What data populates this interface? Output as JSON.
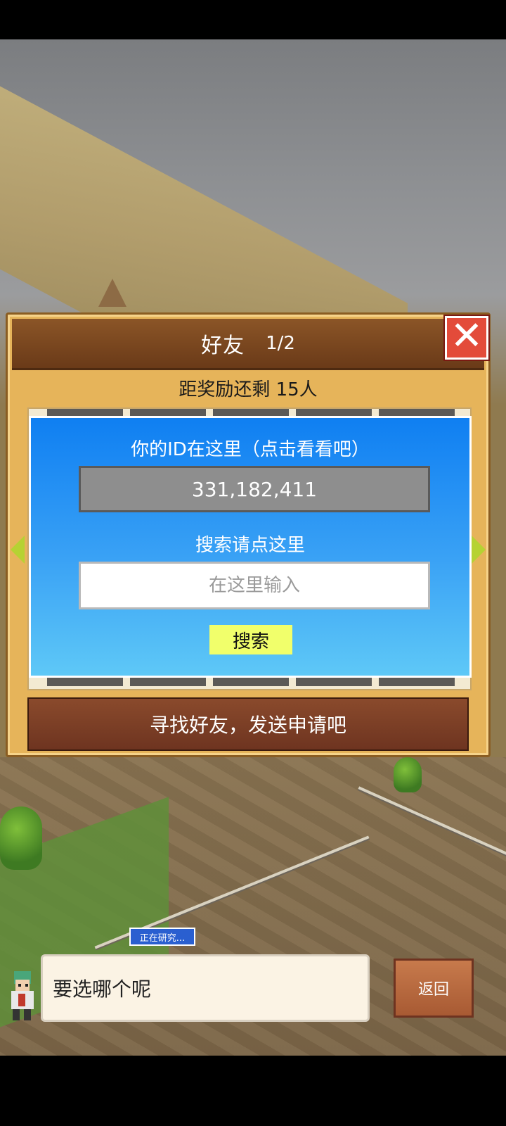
{
  "dialog": {
    "title": "好友",
    "page": "1/2",
    "close_icon": "✕",
    "reward_text": "距奖励还剩 15人",
    "id_label": "你的ID在这里（点击看看吧）",
    "id_value": "331,182,411",
    "search_label": "搜索请点这里",
    "search_placeholder": "在这里输入",
    "search_button": "搜索",
    "find_button": "寻找好友，发送申请吧"
  },
  "status": {
    "research_tag": "正在研究..."
  },
  "speech": {
    "text": "要选哪个呢"
  },
  "controls": {
    "back_label": "返回"
  },
  "colors": {
    "panel_blue": "#0f7ff2",
    "header_brown": "#6a3a18",
    "close_red": "#e34b3a",
    "search_yellow": "#f1ff6b",
    "frame_gold": "#e6b45a"
  }
}
